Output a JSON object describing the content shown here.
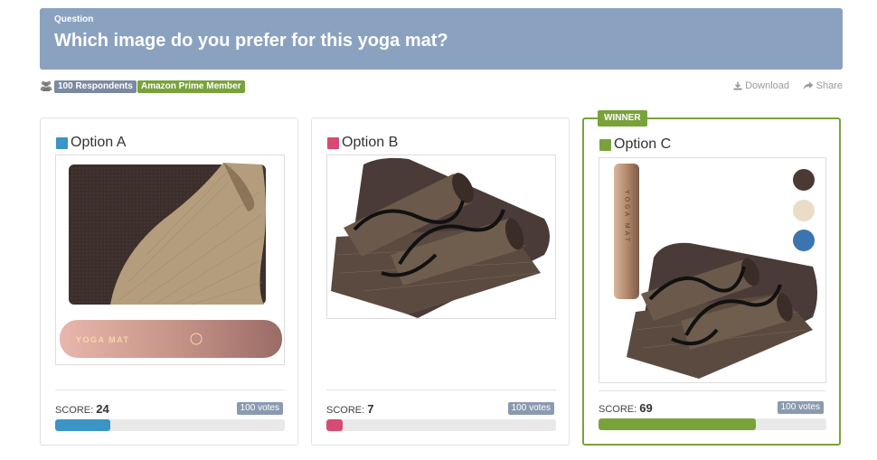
{
  "question": {
    "label": "Question",
    "text": "Which image do you prefer for this yoga mat?"
  },
  "meta": {
    "respondents": "100 Respondents",
    "audience": "Amazon Prime Member",
    "download": "Download",
    "share": "Share"
  },
  "winner_label": "WINNER",
  "score_label": "SCORE:",
  "colors": {
    "banner": "#8aa2c0",
    "prime_badge": "#79a23b",
    "winner_green": "#79a23b"
  },
  "options": [
    {
      "title": "Option A",
      "color": "#3a94c5",
      "score": "24",
      "score_fraction": 0.24,
      "votes": "100 votes",
      "mat_text": "YOGA MAT"
    },
    {
      "title": "Option B",
      "color": "#d84a73",
      "score": "7",
      "score_fraction": 0.07,
      "votes": "100 votes"
    },
    {
      "title": "Option C",
      "color": "#79a23b",
      "score": "69",
      "score_fraction": 0.69,
      "votes": "100 votes",
      "mat_text": "YOGA MAT"
    }
  ]
}
